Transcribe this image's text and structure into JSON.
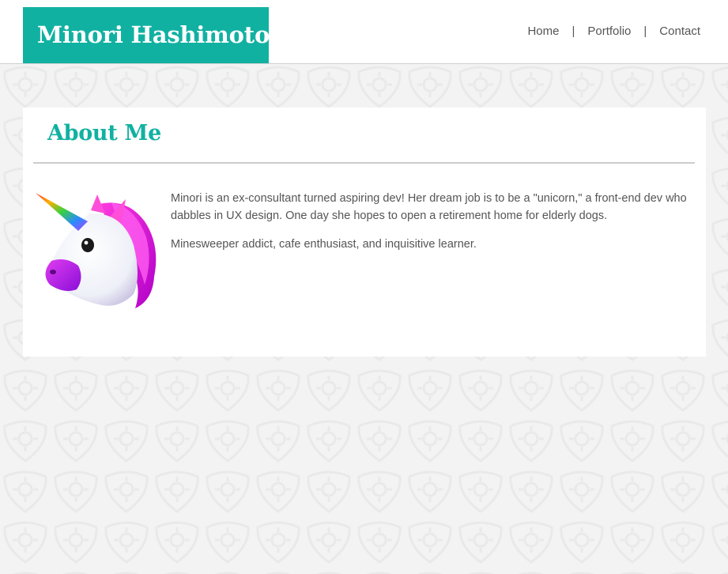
{
  "header": {
    "brand_name": "Minori Hashimoto",
    "nav": {
      "home": "Home",
      "portfolio": "Portfolio",
      "contact": "Contact",
      "separator": "|"
    }
  },
  "about": {
    "heading": "About Me",
    "avatar_icon": "unicorn-icon",
    "paragraphs": [
      "Minori is an ex-consultant turned aspiring dev! Her dream job is to be a \"unicorn,\" a front-end dev who dabbles in UX design. One day she hopes to open a retirement home for elderly dogs.",
      "Minesweeper addict, cafe enthusiast, and inquisitive learner."
    ]
  },
  "colors": {
    "accent": "#11b1a2",
    "text": "#555555",
    "page_background": "#f3f3f3",
    "card_background": "#ffffff"
  }
}
